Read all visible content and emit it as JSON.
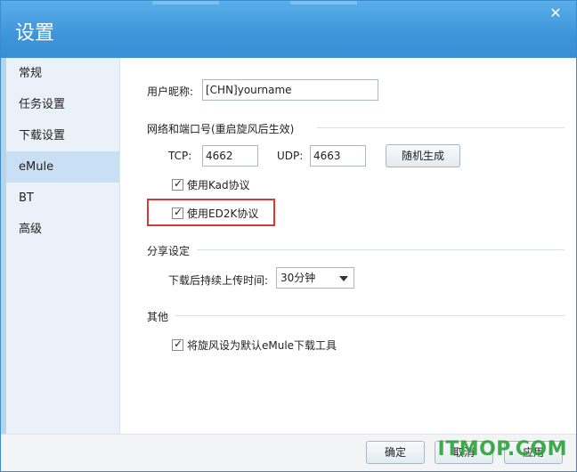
{
  "window": {
    "title": "设置"
  },
  "sidebar": {
    "items": [
      {
        "label": "常规"
      },
      {
        "label": "任务设置"
      },
      {
        "label": "下载设置"
      },
      {
        "label": "eMule"
      },
      {
        "label": "BT"
      },
      {
        "label": "高级"
      }
    ],
    "active_index": 3
  },
  "nickname": {
    "label": "用户昵称:",
    "value": "[CHN]yourname"
  },
  "network": {
    "group_label": "网络和端口号(重启旋风后生效)",
    "tcp_label": "TCP:",
    "tcp_value": "4662",
    "udp_label": "UDP:",
    "udp_value": "4663",
    "random_button": "随机生成",
    "kad_label": "使用Kad协议",
    "kad_checked": true,
    "ed2k_label": "使用ED2K协议",
    "ed2k_checked": true
  },
  "share": {
    "group_label": "分享设定",
    "upload_label": "下载后持续上传时间:",
    "upload_value": "30分钟"
  },
  "other": {
    "group_label": "其他",
    "default_label": "将旋风设为默认eMule下载工具",
    "default_checked": true
  },
  "footer": {
    "ok_button": "确定",
    "cancel_button": "取消",
    "apply_button": "应用"
  },
  "watermark": "ITMOP.COM",
  "colors": {
    "title_bar": "#3d95da",
    "highlight_box": "#d93838",
    "sidebar_active": "#c9dff3"
  }
}
